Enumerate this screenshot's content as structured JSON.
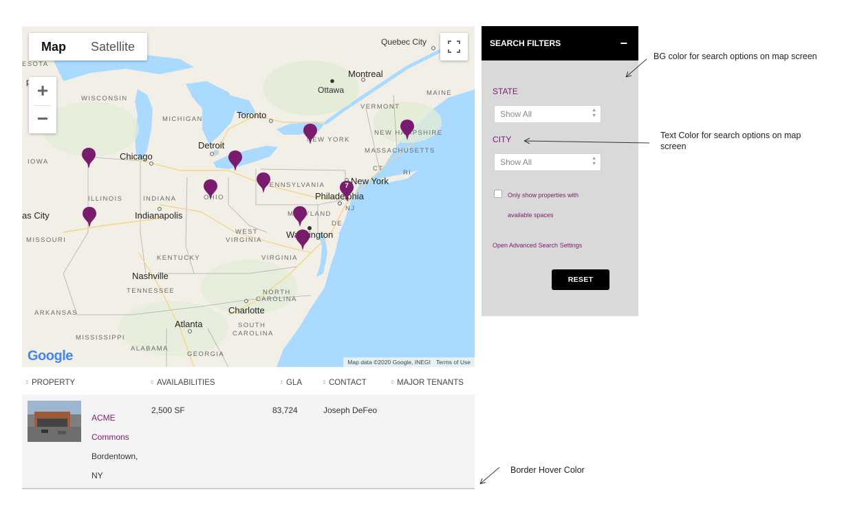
{
  "map": {
    "tabs": [
      {
        "label": "Map",
        "active": true
      },
      {
        "label": "Satellite",
        "active": false
      }
    ],
    "zoom_in": "+",
    "zoom_out": "−",
    "logo": "Google",
    "attribution": "Map data ©2020 Google, INEGI",
    "terms": "Terms of Use",
    "cluster_count": "7",
    "labels": {
      "quebec_city": "Quebec City",
      "montreal": "Montreal",
      "ottawa": "Ottawa",
      "maine": "MAINE",
      "vermont": "VERMONT",
      "new_hampshire": "NEW HAMPSHIRE",
      "massachusetts": "MASSACHUSETTS",
      "ct": "CT",
      "ri": "RI",
      "new_york_state": "NEW YORK",
      "new_york_city": "New York",
      "toronto": "Toronto",
      "detroit": "Detroit",
      "michigan": "MICHIGAN",
      "wisconsin": "WISCONSIN",
      "minneapolis": "polis",
      "minnesota": "ESOTA",
      "iowa": "IOWA",
      "chicago": "Chicago",
      "illinois": "ILLINOIS",
      "indiana": "INDIANA",
      "ohio": "OHIO",
      "pennsylvania": "PENNSYLVANIA",
      "philadelphia": "Philadelphia",
      "nj": "NJ",
      "de": "DE",
      "maryland": "MARYLAND",
      "washington": "Washington",
      "kansas_city": "as City",
      "missouri": "MISSOURI",
      "indianapolis": "Indianapolis",
      "west_virginia_1": "WEST",
      "west_virginia_2": "VIRGINIA",
      "virginia": "VIRGINIA",
      "kentucky": "KENTUCKY",
      "nashville": "Nashville",
      "tennessee": "TENNESSEE",
      "north_carolina_1": "NORTH",
      "north_carolina_2": "CAROLINA",
      "charlotte": "Charlotte",
      "arkansas": "ARKANSAS",
      "atlanta": "Atlanta",
      "south_carolina_1": "SOUTH",
      "south_carolina_2": "CAROLINA",
      "mississippi": "MISSISSIPPI",
      "alabama": "ALABAMA",
      "georgia": "GEORGIA"
    }
  },
  "table": {
    "columns": [
      "PROPERTY",
      "AVAILABILITIES",
      "GLA",
      "CONTACT",
      "MAJOR TENANTS"
    ],
    "rows": [
      {
        "name_line1": "ACME",
        "name_line2": "Commons",
        "city_line1": "Bordentown,",
        "city_line2": "NY",
        "availabilities": "2,500 SF",
        "gla": "83,724",
        "contact": "Joseph DeFeo",
        "tenants": ""
      }
    ]
  },
  "filters": {
    "title": "SEARCH FILTERS",
    "collapse": "−",
    "state_label": "STATE",
    "state_value": "Show All",
    "city_label": "CITY",
    "city_value": "Show All",
    "checkbox_line1": "Only show properties with",
    "checkbox_line2": "available spaces",
    "advanced_link": "Open Advanced Search Settings",
    "reset": "RESET"
  },
  "annotations": {
    "bg_color": "BG color for search options on map screen",
    "text_color_line1": "Text Color for search options on map",
    "text_color_line2": "screen",
    "border_hover": "Border Hover Color"
  },
  "colors": {
    "accent": "#7b1b6e",
    "pin": "#7b1b6e",
    "panel_bg": "#d9d9d9",
    "header_bg": "#000000",
    "water": "#aadaff",
    "land": "#f1efe6"
  }
}
